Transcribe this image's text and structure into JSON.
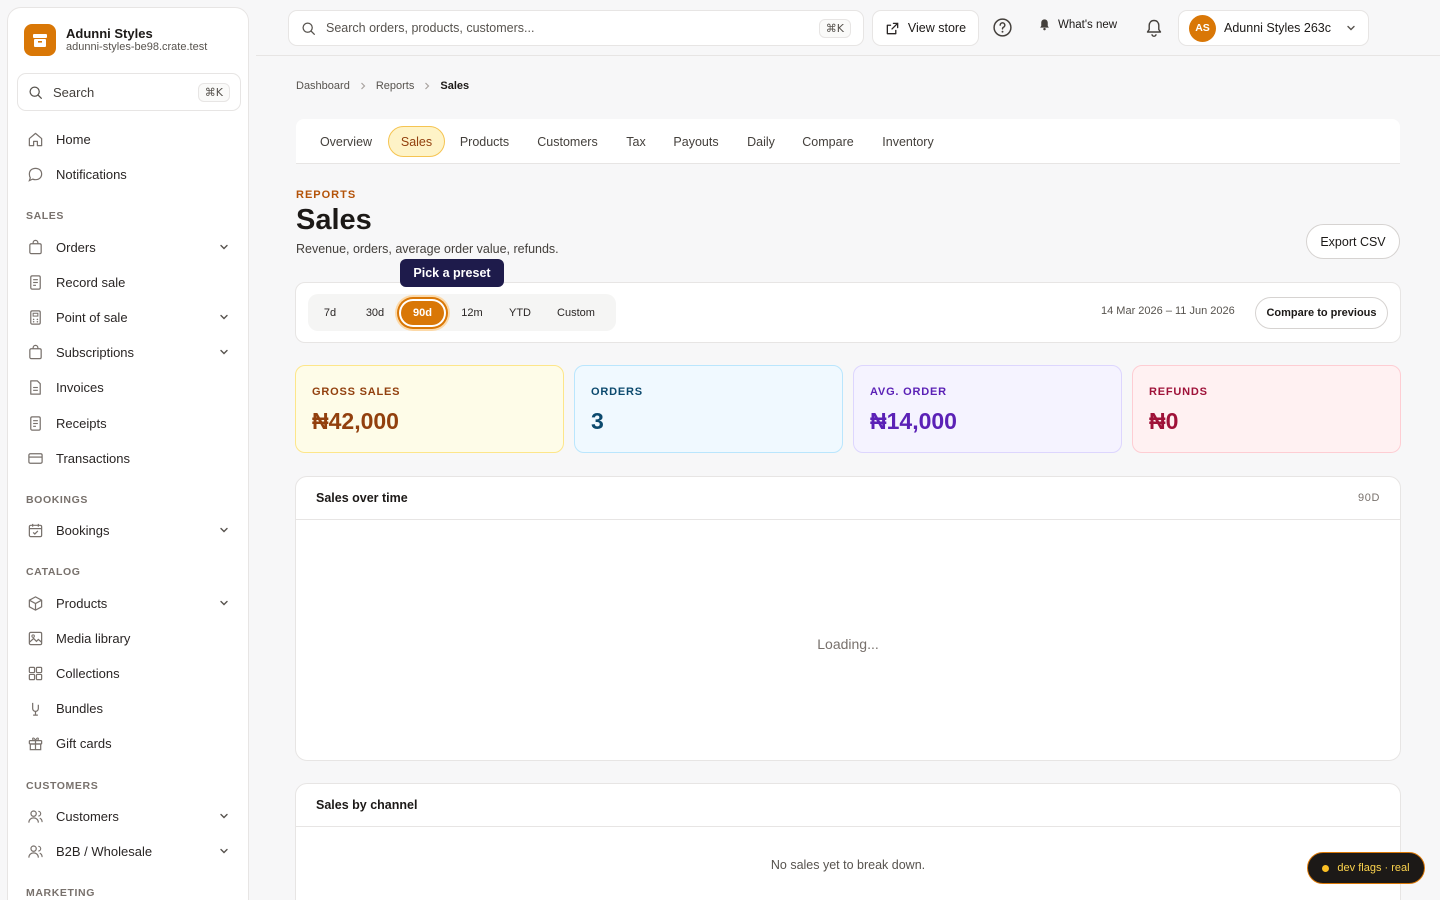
{
  "brand": {
    "name": "Adunni Styles",
    "domain": "adunni-styles-be98.crate.test"
  },
  "sidebar": {
    "search_label": "Search",
    "search_shortcut": "⌘K",
    "items": [
      {
        "label": "Home"
      },
      {
        "label": "Notifications"
      },
      {
        "label": "Orders"
      },
      {
        "label": "Record sale"
      },
      {
        "label": "Point of sale"
      },
      {
        "label": "Subscriptions"
      },
      {
        "label": "Invoices"
      },
      {
        "label": "Receipts"
      },
      {
        "label": "Transactions"
      },
      {
        "label": "Bookings"
      },
      {
        "label": "Products"
      },
      {
        "label": "Media library"
      },
      {
        "label": "Collections"
      },
      {
        "label": "Bundles"
      },
      {
        "label": "Gift cards"
      },
      {
        "label": "Customers"
      },
      {
        "label": "B2B / Wholesale"
      }
    ],
    "sections": [
      "SALES",
      "BOOKINGS",
      "CATALOG",
      "CUSTOMERS",
      "MARKETING"
    ]
  },
  "topbar": {
    "search_placeholder": "Search orders, products, customers...",
    "search_shortcut": "⌘K",
    "view_store": "View store",
    "whats_new": "What's new",
    "account_initials": "AS",
    "account_name": "Adunni Styles 263c"
  },
  "breadcrumb": [
    "Dashboard",
    "Reports",
    "Sales"
  ],
  "tabs": [
    "Overview",
    "Sales",
    "Products",
    "Customers",
    "Tax",
    "Payouts",
    "Daily",
    "Compare",
    "Inventory"
  ],
  "active_tab": "Sales",
  "header": {
    "eyebrow": "REPORTS",
    "title": "Sales",
    "subtitle": "Revenue, orders, average order value, refunds.",
    "export_label": "Export CSV"
  },
  "range": {
    "presets": [
      "7d",
      "30d",
      "90d",
      "12m",
      "YTD",
      "Custom"
    ],
    "active_preset": "90d",
    "tooltip": "Pick a preset",
    "dates": "14 Mar 2026 – 11 Jun 2026",
    "compare_label": "Compare to previous"
  },
  "kpis": [
    {
      "label": "GROSS SALES",
      "value": "₦42,000",
      "color": "#92400e",
      "bg": "#fefce8",
      "border": "#fde68a"
    },
    {
      "label": "ORDERS",
      "value": "3",
      "color": "#0c4a6e",
      "bg": "#f0f9ff",
      "border": "#bae6fd"
    },
    {
      "label": "AVG. ORDER",
      "value": "₦14,000",
      "color": "#5b21b6",
      "bg": "#f5f3ff",
      "border": "#ddd6fe"
    },
    {
      "label": "REFUNDS",
      "value": "₦0",
      "color": "#9f1239",
      "bg": "#fff1f2",
      "border": "#fecdd3"
    }
  ],
  "sales_over_time": {
    "title": "Sales over time",
    "tag": "90D",
    "status": "Loading..."
  },
  "sales_by_channel": {
    "title": "Sales by channel",
    "empty": "No sales yet to break down."
  },
  "dev_flags": "dev flags · real",
  "colors": {
    "accent": "#d97706",
    "tooltip_bg": "#1e1b4b"
  }
}
